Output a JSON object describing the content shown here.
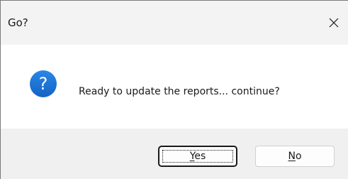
{
  "window": {
    "title": "Go?",
    "close_icon": "close-icon"
  },
  "content": {
    "icon": "question-icon",
    "icon_color": "#1c6fd1",
    "message": "Ready to update the reports... continue?"
  },
  "buttons": {
    "yes": {
      "mnemonic": "Y",
      "rest": "es",
      "is_default": true
    },
    "no": {
      "mnemonic": "N",
      "rest": "o",
      "is_default": false
    }
  }
}
